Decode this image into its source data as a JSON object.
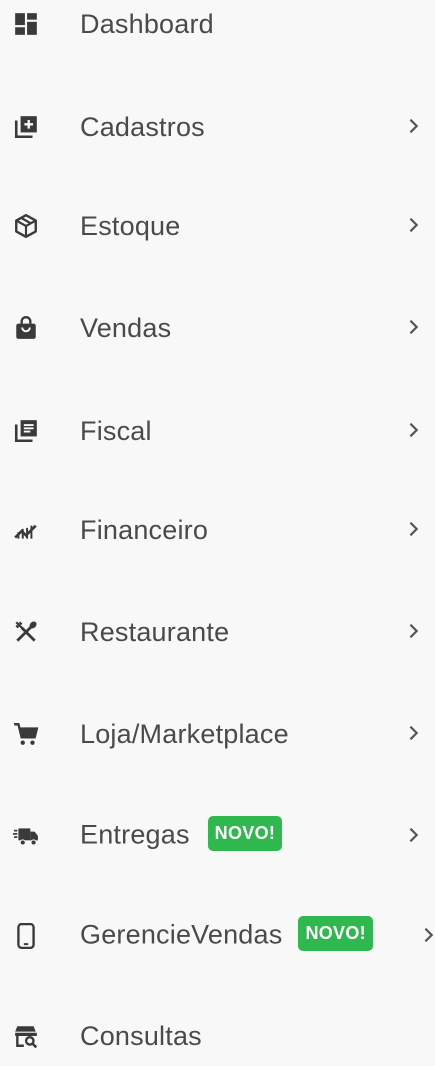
{
  "menu": {
    "items": [
      {
        "label": "Dashboard",
        "icon": "dashboard-icon",
        "has_chevron": false
      },
      {
        "label": "Cadastros",
        "icon": "add-box-icon",
        "has_chevron": true
      },
      {
        "label": "Estoque",
        "icon": "box-icon",
        "has_chevron": true
      },
      {
        "label": "Vendas",
        "icon": "shopping-bag-icon",
        "has_chevron": true
      },
      {
        "label": "Fiscal",
        "icon": "document-list-icon",
        "has_chevron": true
      },
      {
        "label": "Financeiro",
        "icon": "chart-up-icon",
        "has_chevron": true
      },
      {
        "label": "Restaurante",
        "icon": "utensils-icon",
        "has_chevron": true
      },
      {
        "label": "Loja/Marketplace",
        "icon": "cart-icon",
        "has_chevron": true
      },
      {
        "label": "Entregas",
        "icon": "truck-icon",
        "has_chevron": true,
        "badge": "NOVO!"
      },
      {
        "label": "GerencieVendas",
        "icon": "smartphone-icon",
        "has_chevron": true,
        "badge": "NOVO!"
      },
      {
        "label": "Consultas",
        "icon": "search-register-icon",
        "has_chevron": false
      }
    ]
  },
  "colors": {
    "text": "#4a4a4a",
    "icon": "#3a3a3a",
    "badge": "#2eb84e",
    "background": "#f8f8f8"
  }
}
